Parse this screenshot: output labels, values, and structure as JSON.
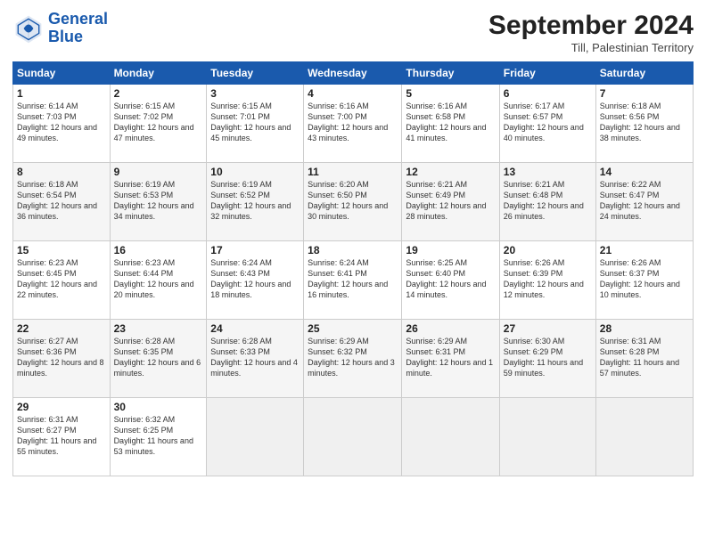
{
  "header": {
    "logo_line1": "General",
    "logo_line2": "Blue",
    "month": "September 2024",
    "location": "Till, Palestinian Territory"
  },
  "days_of_week": [
    "Sunday",
    "Monday",
    "Tuesday",
    "Wednesday",
    "Thursday",
    "Friday",
    "Saturday"
  ],
  "weeks": [
    [
      {
        "day": "1",
        "sunrise": "Sunrise: 6:14 AM",
        "sunset": "Sunset: 7:03 PM",
        "daylight": "Daylight: 12 hours and 49 minutes."
      },
      {
        "day": "2",
        "sunrise": "Sunrise: 6:15 AM",
        "sunset": "Sunset: 7:02 PM",
        "daylight": "Daylight: 12 hours and 47 minutes."
      },
      {
        "day": "3",
        "sunrise": "Sunrise: 6:15 AM",
        "sunset": "Sunset: 7:01 PM",
        "daylight": "Daylight: 12 hours and 45 minutes."
      },
      {
        "day": "4",
        "sunrise": "Sunrise: 6:16 AM",
        "sunset": "Sunset: 7:00 PM",
        "daylight": "Daylight: 12 hours and 43 minutes."
      },
      {
        "day": "5",
        "sunrise": "Sunrise: 6:16 AM",
        "sunset": "Sunset: 6:58 PM",
        "daylight": "Daylight: 12 hours and 41 minutes."
      },
      {
        "day": "6",
        "sunrise": "Sunrise: 6:17 AM",
        "sunset": "Sunset: 6:57 PM",
        "daylight": "Daylight: 12 hours and 40 minutes."
      },
      {
        "day": "7",
        "sunrise": "Sunrise: 6:18 AM",
        "sunset": "Sunset: 6:56 PM",
        "daylight": "Daylight: 12 hours and 38 minutes."
      }
    ],
    [
      {
        "day": "8",
        "sunrise": "Sunrise: 6:18 AM",
        "sunset": "Sunset: 6:54 PM",
        "daylight": "Daylight: 12 hours and 36 minutes."
      },
      {
        "day": "9",
        "sunrise": "Sunrise: 6:19 AM",
        "sunset": "Sunset: 6:53 PM",
        "daylight": "Daylight: 12 hours and 34 minutes."
      },
      {
        "day": "10",
        "sunrise": "Sunrise: 6:19 AM",
        "sunset": "Sunset: 6:52 PM",
        "daylight": "Daylight: 12 hours and 32 minutes."
      },
      {
        "day": "11",
        "sunrise": "Sunrise: 6:20 AM",
        "sunset": "Sunset: 6:50 PM",
        "daylight": "Daylight: 12 hours and 30 minutes."
      },
      {
        "day": "12",
        "sunrise": "Sunrise: 6:21 AM",
        "sunset": "Sunset: 6:49 PM",
        "daylight": "Daylight: 12 hours and 28 minutes."
      },
      {
        "day": "13",
        "sunrise": "Sunrise: 6:21 AM",
        "sunset": "Sunset: 6:48 PM",
        "daylight": "Daylight: 12 hours and 26 minutes."
      },
      {
        "day": "14",
        "sunrise": "Sunrise: 6:22 AM",
        "sunset": "Sunset: 6:47 PM",
        "daylight": "Daylight: 12 hours and 24 minutes."
      }
    ],
    [
      {
        "day": "15",
        "sunrise": "Sunrise: 6:23 AM",
        "sunset": "Sunset: 6:45 PM",
        "daylight": "Daylight: 12 hours and 22 minutes."
      },
      {
        "day": "16",
        "sunrise": "Sunrise: 6:23 AM",
        "sunset": "Sunset: 6:44 PM",
        "daylight": "Daylight: 12 hours and 20 minutes."
      },
      {
        "day": "17",
        "sunrise": "Sunrise: 6:24 AM",
        "sunset": "Sunset: 6:43 PM",
        "daylight": "Daylight: 12 hours and 18 minutes."
      },
      {
        "day": "18",
        "sunrise": "Sunrise: 6:24 AM",
        "sunset": "Sunset: 6:41 PM",
        "daylight": "Daylight: 12 hours and 16 minutes."
      },
      {
        "day": "19",
        "sunrise": "Sunrise: 6:25 AM",
        "sunset": "Sunset: 6:40 PM",
        "daylight": "Daylight: 12 hours and 14 minutes."
      },
      {
        "day": "20",
        "sunrise": "Sunrise: 6:26 AM",
        "sunset": "Sunset: 6:39 PM",
        "daylight": "Daylight: 12 hours and 12 minutes."
      },
      {
        "day": "21",
        "sunrise": "Sunrise: 6:26 AM",
        "sunset": "Sunset: 6:37 PM",
        "daylight": "Daylight: 12 hours and 10 minutes."
      }
    ],
    [
      {
        "day": "22",
        "sunrise": "Sunrise: 6:27 AM",
        "sunset": "Sunset: 6:36 PM",
        "daylight": "Daylight: 12 hours and 8 minutes."
      },
      {
        "day": "23",
        "sunrise": "Sunrise: 6:28 AM",
        "sunset": "Sunset: 6:35 PM",
        "daylight": "Daylight: 12 hours and 6 minutes."
      },
      {
        "day": "24",
        "sunrise": "Sunrise: 6:28 AM",
        "sunset": "Sunset: 6:33 PM",
        "daylight": "Daylight: 12 hours and 4 minutes."
      },
      {
        "day": "25",
        "sunrise": "Sunrise: 6:29 AM",
        "sunset": "Sunset: 6:32 PM",
        "daylight": "Daylight: 12 hours and 3 minutes."
      },
      {
        "day": "26",
        "sunrise": "Sunrise: 6:29 AM",
        "sunset": "Sunset: 6:31 PM",
        "daylight": "Daylight: 12 hours and 1 minute."
      },
      {
        "day": "27",
        "sunrise": "Sunrise: 6:30 AM",
        "sunset": "Sunset: 6:29 PM",
        "daylight": "Daylight: 11 hours and 59 minutes."
      },
      {
        "day": "28",
        "sunrise": "Sunrise: 6:31 AM",
        "sunset": "Sunset: 6:28 PM",
        "daylight": "Daylight: 11 hours and 57 minutes."
      }
    ],
    [
      {
        "day": "29",
        "sunrise": "Sunrise: 6:31 AM",
        "sunset": "Sunset: 6:27 PM",
        "daylight": "Daylight: 11 hours and 55 minutes."
      },
      {
        "day": "30",
        "sunrise": "Sunrise: 6:32 AM",
        "sunset": "Sunset: 6:25 PM",
        "daylight": "Daylight: 11 hours and 53 minutes."
      },
      null,
      null,
      null,
      null,
      null
    ]
  ]
}
